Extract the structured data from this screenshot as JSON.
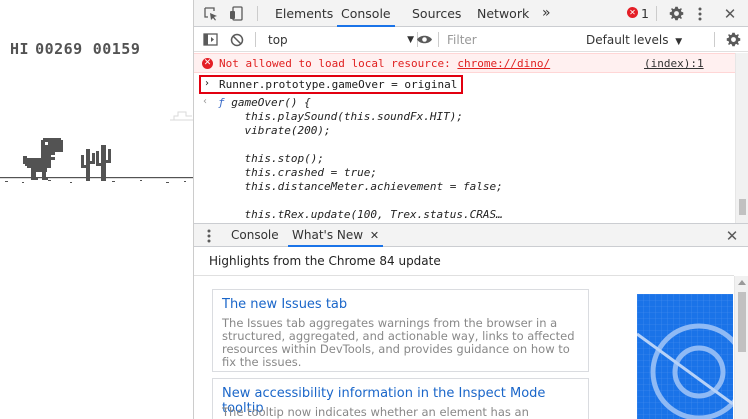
{
  "game": {
    "hi_label": "HI",
    "hi_score": "00269",
    "current_score": "00159"
  },
  "devtools": {
    "tabs": [
      {
        "label": "Elements",
        "active": false
      },
      {
        "label": "Console",
        "active": true
      },
      {
        "label": "Sources",
        "active": false
      },
      {
        "label": "Network",
        "active": false
      }
    ],
    "more_tabs_glyph": "»",
    "error_count": "1",
    "toolbar_icons": [
      "inspect-element-icon",
      "device-toolbar-icon",
      "settings-gear-icon",
      "kebab-menu-icon",
      "close-icon"
    ]
  },
  "console_toolbar": {
    "context": "top",
    "filter_placeholder": "Filter",
    "levels": "Default levels",
    "levels_arrow": "▼"
  },
  "console": {
    "error_message": "Not allowed to load local resource: ",
    "error_link": "chrome://dino/",
    "error_source": "(index):1",
    "input_prompt": "›",
    "input_code": "Runner.prototype.gameOver = original",
    "output_prompt": "‹",
    "output_lines": [
      {
        "kw": "ƒ",
        "text": " gameOver() {"
      },
      {
        "kw": "",
        "text": "    this.playSound(this.soundFx.HIT);"
      },
      {
        "kw": "",
        "text": "    vibrate(200);"
      },
      {
        "kw": "",
        "text": ""
      },
      {
        "kw": "",
        "text": "    this.stop();"
      },
      {
        "kw": "",
        "text": "    this.crashed = true;"
      },
      {
        "kw": "",
        "text": "    this.distanceMeter.achievement = false;"
      },
      {
        "kw": "",
        "text": ""
      },
      {
        "kw": "",
        "text": "    this.tRex.update(100, Trex.status.CRAS…"
      }
    ]
  },
  "drawer": {
    "tabs": [
      {
        "label": "Console",
        "active": false
      },
      {
        "label": "What's New",
        "active": true
      }
    ],
    "close_glyph": "✕",
    "highlights_title": "Highlights from the Chrome 84 update",
    "cards": [
      {
        "title": "The new Issues tab",
        "description": "The Issues tab aggregates warnings from the browser in a structured, aggregated, and actionable way, links to affected resources within DevTools, and provides guidance on how to fix the issues."
      },
      {
        "title": "New accessibility information in the Inspect Mode tooltip",
        "description": "The tooltip now indicates whether an element has an"
      }
    ]
  },
  "colors": {
    "accent": "#1a73e8",
    "error_red": "#e41e26",
    "dino_gray": "#535353"
  }
}
